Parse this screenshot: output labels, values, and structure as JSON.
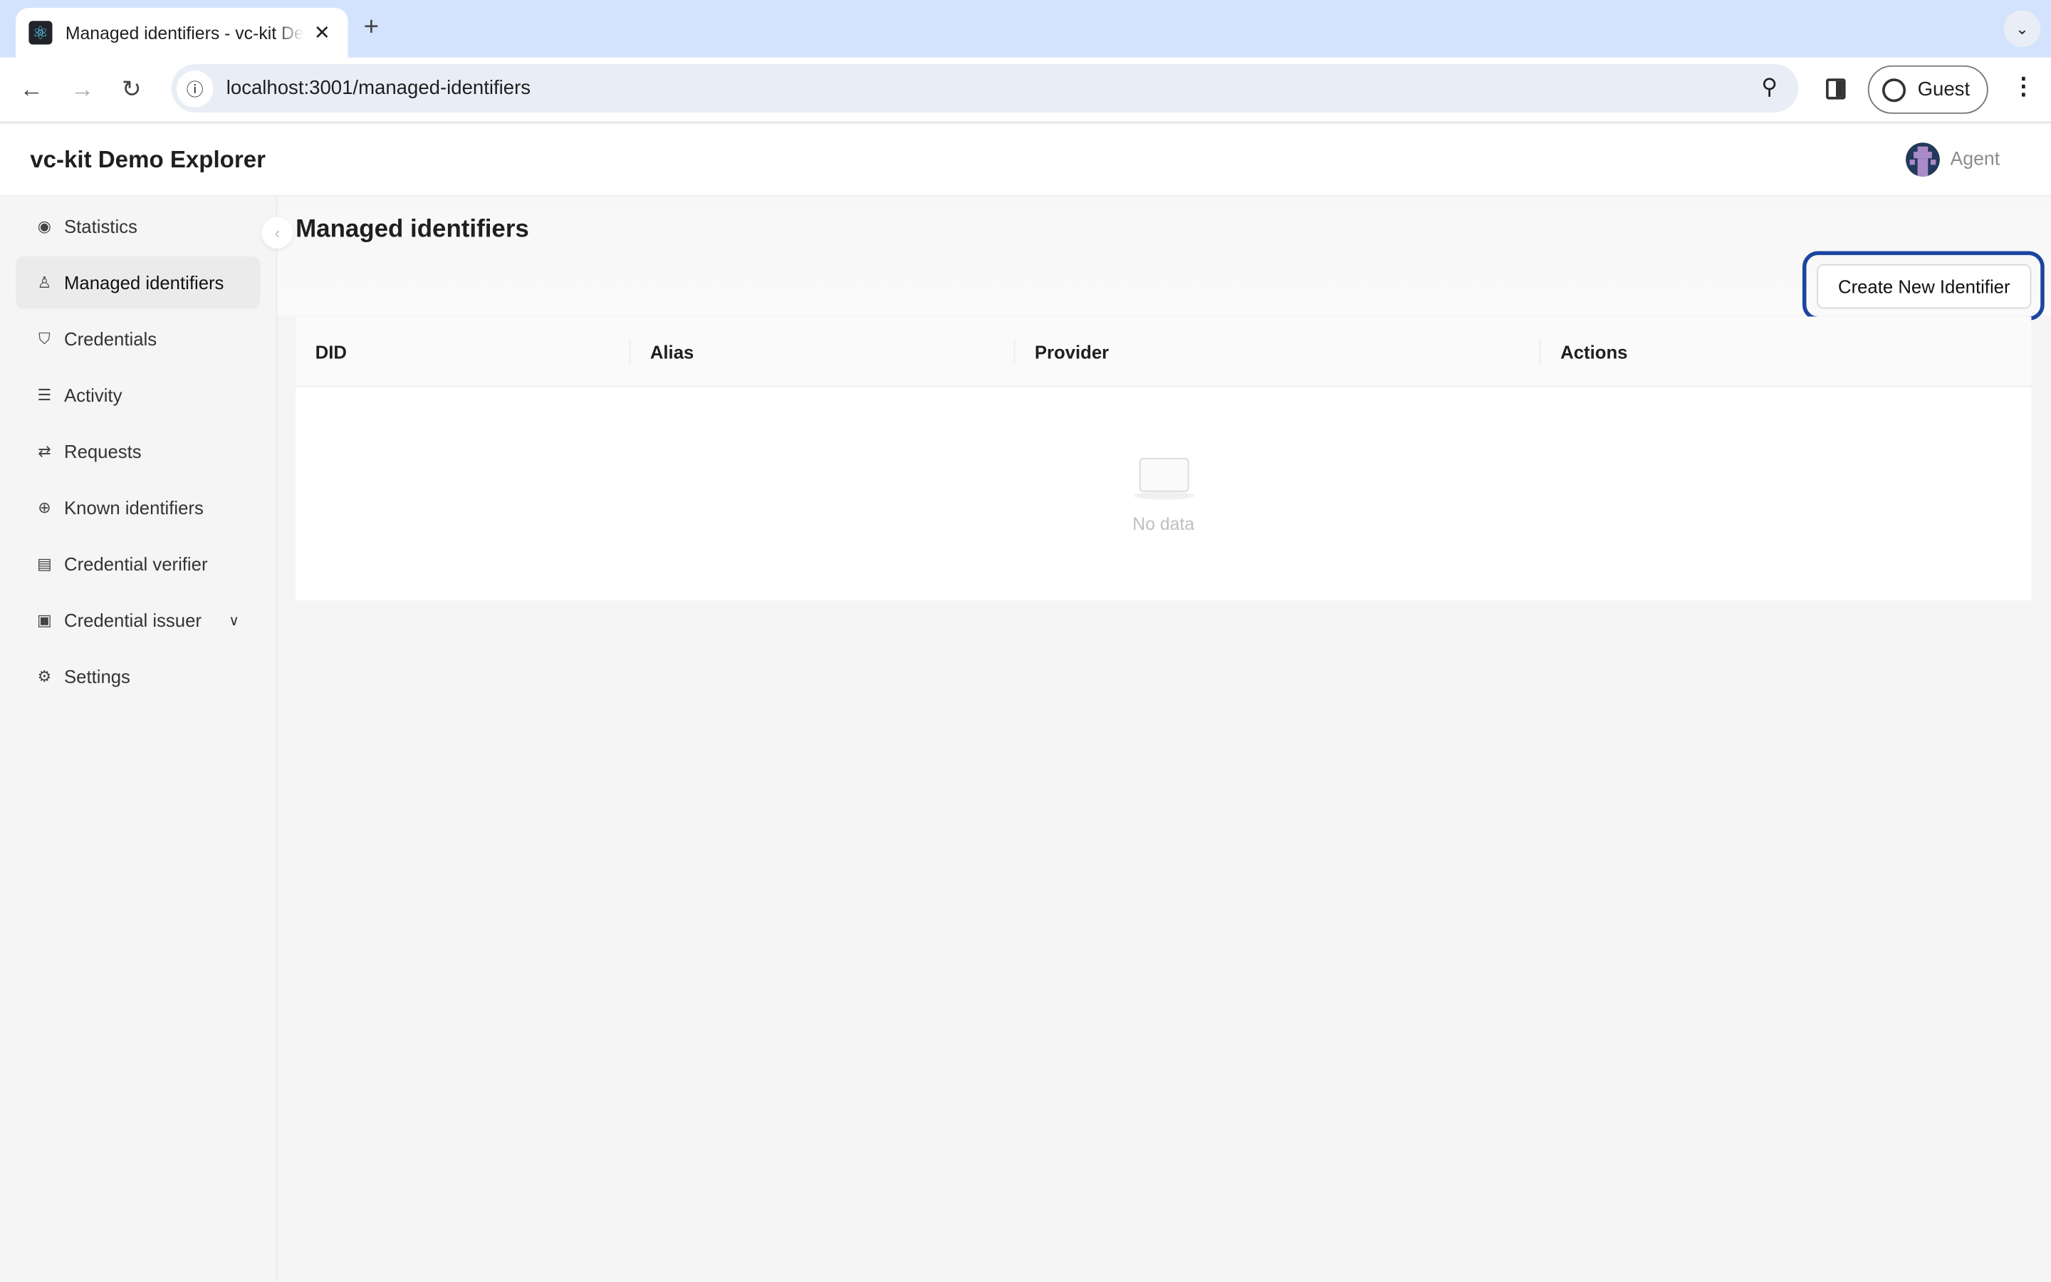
{
  "browser": {
    "tab_title": "Managed identifiers - vc-kit Demo Explorer",
    "url": "localhost:3001/managed-identifiers",
    "profile": "Guest"
  },
  "app": {
    "brand": "vc-kit Demo Explorer",
    "user": "Agent"
  },
  "sidebar": {
    "items": [
      {
        "label": "Statistics",
        "icon": "eye-icon"
      },
      {
        "label": "Managed identifiers",
        "icon": "user-icon",
        "active": true
      },
      {
        "label": "Credentials",
        "icon": "shield-check-icon"
      },
      {
        "label": "Activity",
        "icon": "list-icon"
      },
      {
        "label": "Requests",
        "icon": "swap-icon"
      },
      {
        "label": "Known identifiers",
        "icon": "globe-icon"
      },
      {
        "label": "Credential verifier",
        "icon": "file-check-icon"
      },
      {
        "label": "Credential issuer",
        "icon": "terminal-icon",
        "expandable": true
      },
      {
        "label": "Settings",
        "icon": "gear-icon"
      }
    ]
  },
  "main": {
    "title": "Managed identifiers",
    "create_button": "Create New Identifier",
    "table": {
      "columns": [
        "DID",
        "Alias",
        "Provider",
        "Actions"
      ],
      "rows": [],
      "empty_text": "No data"
    }
  },
  "colors": {
    "focus_ring": "#1c45a0",
    "tab_strip": "#d3e3fd"
  }
}
